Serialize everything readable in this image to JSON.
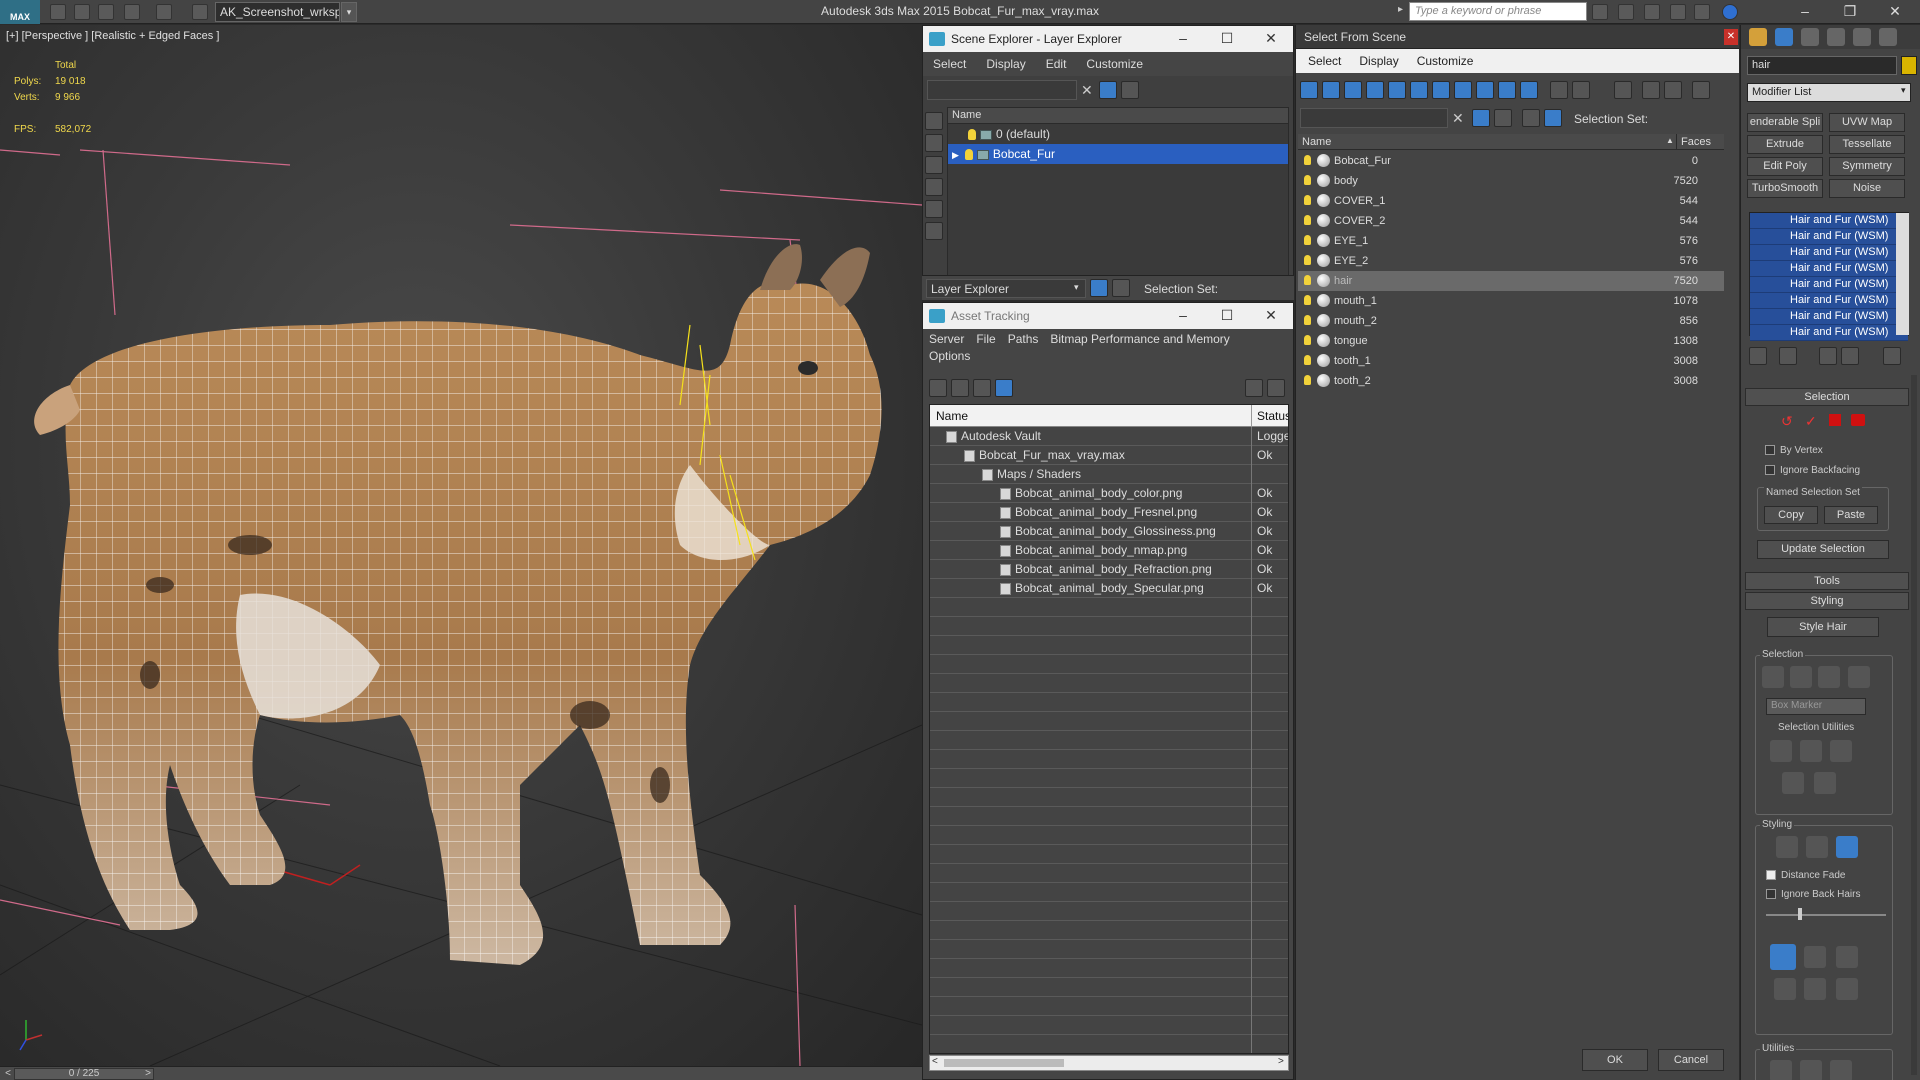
{
  "titlebar": {
    "logo": "MAX",
    "workspace": "AK_Screenshot_wrksp",
    "app_title": "Autodesk 3ds Max  2015     Bobcat_Fur_max_vray.max",
    "search_placeholder": "Type a keyword or phrase"
  },
  "viewport": {
    "label": "[+] [Perspective ] [Realistic + Edged Faces ]",
    "stats_total": "Total",
    "polys_label": "Polys:",
    "polys_value": "19 018",
    "verts_label": "Verts:",
    "verts_value": "9 966",
    "fps_label": "FPS:",
    "fps_value": "582,072",
    "timeline": "0 / 225"
  },
  "scene_explorer": {
    "title": "Scene Explorer - Layer Explorer",
    "menu": [
      "Select",
      "Display",
      "Edit",
      "Customize"
    ],
    "col_name": "Name",
    "layers": [
      "0 (default)",
      "Bobcat_Fur"
    ],
    "layer_dropdown": "Layer Explorer",
    "selection_set": "Selection Set:"
  },
  "asset_tracking": {
    "title": "Asset Tracking",
    "menu": [
      "Server",
      "File",
      "Paths",
      "Bitmap Performance and Memory"
    ],
    "menu2": "Options",
    "col_name": "Name",
    "col_status": "Status",
    "rows": [
      {
        "name": "Autodesk Vault",
        "status": "Logged"
      },
      {
        "name": "Bobcat_Fur_max_vray.max",
        "status": "Ok"
      },
      {
        "name": "Maps / Shaders",
        "status": ""
      },
      {
        "name": "Bobcat_animal_body_color.png",
        "status": "Ok"
      },
      {
        "name": "Bobcat_animal_body_Fresnel.png",
        "status": "Ok"
      },
      {
        "name": "Bobcat_animal_body_Glossiness.png",
        "status": "Ok"
      },
      {
        "name": "Bobcat_animal_body_nmap.png",
        "status": "Ok"
      },
      {
        "name": "Bobcat_animal_body_Refraction.png",
        "status": "Ok"
      },
      {
        "name": "Bobcat_animal_body_Specular.png",
        "status": "Ok"
      }
    ]
  },
  "select_from_scene": {
    "title": "Select From Scene",
    "menu": [
      "Select",
      "Display",
      "Customize"
    ],
    "selection_set": "Selection Set:",
    "col_name": "Name",
    "col_faces": "Faces",
    "rows": [
      {
        "name": "Bobcat_Fur",
        "faces": "0"
      },
      {
        "name": "body",
        "faces": "7520"
      },
      {
        "name": "COVER_1",
        "faces": "544"
      },
      {
        "name": "COVER_2",
        "faces": "544"
      },
      {
        "name": "EYE_1",
        "faces": "576"
      },
      {
        "name": "EYE_2",
        "faces": "576"
      },
      {
        "name": "hair",
        "faces": "7520"
      },
      {
        "name": "mouth_1",
        "faces": "1078"
      },
      {
        "name": "mouth_2",
        "faces": "856"
      },
      {
        "name": "tongue",
        "faces": "1308"
      },
      {
        "name": "tooth_1",
        "faces": "3008"
      },
      {
        "name": "tooth_2",
        "faces": "3008"
      }
    ],
    "ok": "OK",
    "cancel": "Cancel"
  },
  "command_panel": {
    "object_name": "hair",
    "modifier_list": "Modifier List",
    "buttons": [
      "enderable Spli",
      "UVW Map",
      "Extrude",
      "Tessellate",
      "Edit Poly",
      "Symmetry",
      "TurboSmooth",
      "Noise"
    ],
    "stack": [
      "Hair and Fur (WSM)",
      "Hair and Fur (WSM)",
      "Hair and Fur (WSM)",
      "Hair and Fur (WSM)",
      "Hair and Fur (WSM)",
      "Hair and Fur (WSM)",
      "Hair and Fur (WSM)",
      "Hair and Fur (WSM)"
    ],
    "selection": {
      "title": "Selection",
      "by_vertex": "By Vertex",
      "ignore_backfacing": "Ignore Backfacing",
      "named_set": "Named Selection Set",
      "copy": "Copy",
      "paste": "Paste",
      "update": "Update Selection"
    },
    "tools_title": "Tools",
    "styling_title": "Styling",
    "style_hair": "Style Hair",
    "sel_group": "Selection",
    "box_marker": "Box Marker",
    "sel_utils": "Selection Utilities",
    "styling_group": "Styling",
    "distance_fade": "Distance Fade",
    "ignore_back_hairs": "Ignore Back Hairs",
    "utilities": "Utilities"
  },
  "colors": {
    "accent_blue": "#2a5fc0",
    "bulb_yellow": "#f2d23a",
    "stat_yellow": "#f0d84c"
  }
}
